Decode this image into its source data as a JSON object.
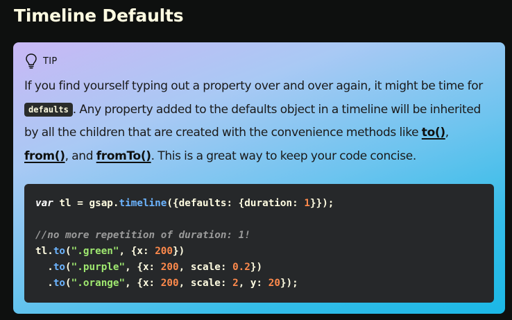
{
  "page": {
    "title": "Timeline Defaults"
  },
  "tip": {
    "label": "TIP",
    "icon": "lightbulb-icon",
    "text_1": "If you find yourself typing out a property over and over again, it might be time for ",
    "inline_code": "defaults",
    "text_2": ". Any property added to the defaults object in a timeline will be inherited by all the children that are created with the convenience methods like ",
    "link_to": "to()",
    "sep_1": ", ",
    "link_from": "from()",
    "sep_2": ", and ",
    "link_fromto": "fromTo()",
    "text_3": ". This is a great way to keep your code concise."
  },
  "code": {
    "line1": {
      "kw": "var",
      "p1": " tl = gsap.",
      "fn": "timeline",
      "p2": "({defaults: {duration: ",
      "num": "1",
      "p3": "}});"
    },
    "line3": {
      "comment": "//no more repetition of duration: 1!"
    },
    "line4": {
      "p1": "tl.",
      "fn": "to",
      "p2": "(",
      "str": "\".green\"",
      "p3": ", {x: ",
      "num": "200",
      "p4": "})"
    },
    "line5": {
      "p1": "  .",
      "fn": "to",
      "p2": "(",
      "str": "\".purple\"",
      "p3": ", {x: ",
      "num1": "200",
      "p4": ", scale: ",
      "num2": "0.2",
      "p5": "})"
    },
    "line6": {
      "p1": "  .",
      "fn": "to",
      "p2": "(",
      "str": "\".orange\"",
      "p3": ", {x: ",
      "num1": "200",
      "p4": ", scale: ",
      "num2": "2",
      "p5": ", y: ",
      "num3": "20",
      "p6": "});"
    }
  },
  "colors": {
    "background": "#0e100f",
    "title": "#fffce1",
    "code_bg": "#26282a",
    "function": "#6cb4ff",
    "string": "#9fe870",
    "number": "#ff8a4c",
    "comment": "#9b9b9b"
  }
}
